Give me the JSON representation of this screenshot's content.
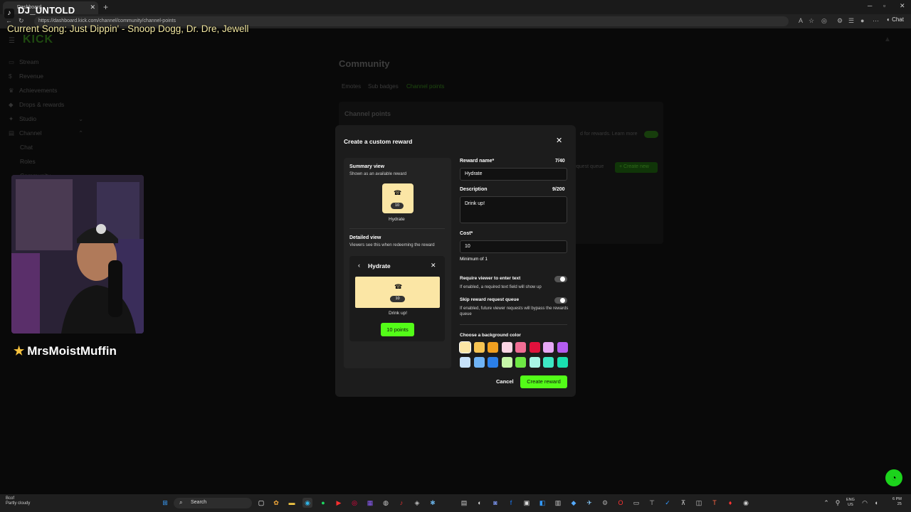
{
  "browser": {
    "tab_title": "Dashboard",
    "url": "https://dashboard.kick.com/channel/community/channel-points",
    "chat_button": "Chat"
  },
  "overlay": {
    "tiktok_handle": "DJ_UNTOLD",
    "now_playing": "Current Song: Just Dippin' - Snoop Dogg, Dr. Dre, Jewell",
    "webcam_name": "MrsMoistMuffin"
  },
  "sidebar": {
    "items": [
      {
        "label": "Stream"
      },
      {
        "label": "Revenue"
      },
      {
        "label": "Achievements"
      },
      {
        "label": "Drops & rewards"
      },
      {
        "label": "Studio"
      },
      {
        "label": "Channel"
      }
    ],
    "subitems": [
      {
        "label": "Chat"
      },
      {
        "label": "Roles"
      },
      {
        "label": "Community"
      }
    ]
  },
  "page": {
    "title": "Community",
    "tabs": [
      {
        "label": "Emotes"
      },
      {
        "label": "Sub badges"
      },
      {
        "label": "Channel points"
      }
    ],
    "section_title": "Channel points",
    "learn_more": "d for rewards. Learn more",
    "queue_text": "equest queue",
    "create_new": "+ Create new"
  },
  "modal": {
    "title": "Create a custom reward",
    "summary_title": "Summary view",
    "summary_sub": "Shown as an available reward",
    "detail_title": "Detailed view",
    "detail_sub": "Viewers see this when redeeming the reward",
    "reward_name_label": "Reward name*",
    "reward_name_count": "7/40",
    "reward_name_value": "Hydrate",
    "description_label": "Description",
    "description_count": "9/200",
    "description_value": "Drink up!",
    "cost_label": "Cost*",
    "cost_value": "10",
    "cost_hint": "Minimum of 1",
    "require_text_label": "Require viewer to enter text",
    "require_text_hint": "If enabled, a required text field will show up",
    "skip_queue_label": "Skip reward request queue",
    "skip_queue_hint": "If enabled, future viewer requests will bypass the rewards queue",
    "color_label": "Choose a background color",
    "colors_row1": [
      "#fbe6a5",
      "#f6c453",
      "#f0a020",
      "#fbd5e4",
      "#f06d94",
      "#e0113c",
      "#e6a8f5",
      "#b45cf0"
    ],
    "colors_row2": [
      "#c8e3fb",
      "#70b4f6",
      "#2b7fe8",
      "#c6f6a8",
      "#6ee844",
      "#a8f5e6",
      "#3ee8c4",
      "#19e0b0"
    ],
    "selected_color": "#fbe6a5",
    "points_button": "10 points",
    "preview_cost": "10",
    "cancel": "Cancel",
    "create": "Create reward"
  },
  "taskbar": {
    "weather_temp": "Bcof",
    "weather_text": "Partly cloudy",
    "search_placeholder": "Search",
    "lang": "ENG",
    "lang_region": "US",
    "time": "6 PM",
    "date": "25"
  }
}
